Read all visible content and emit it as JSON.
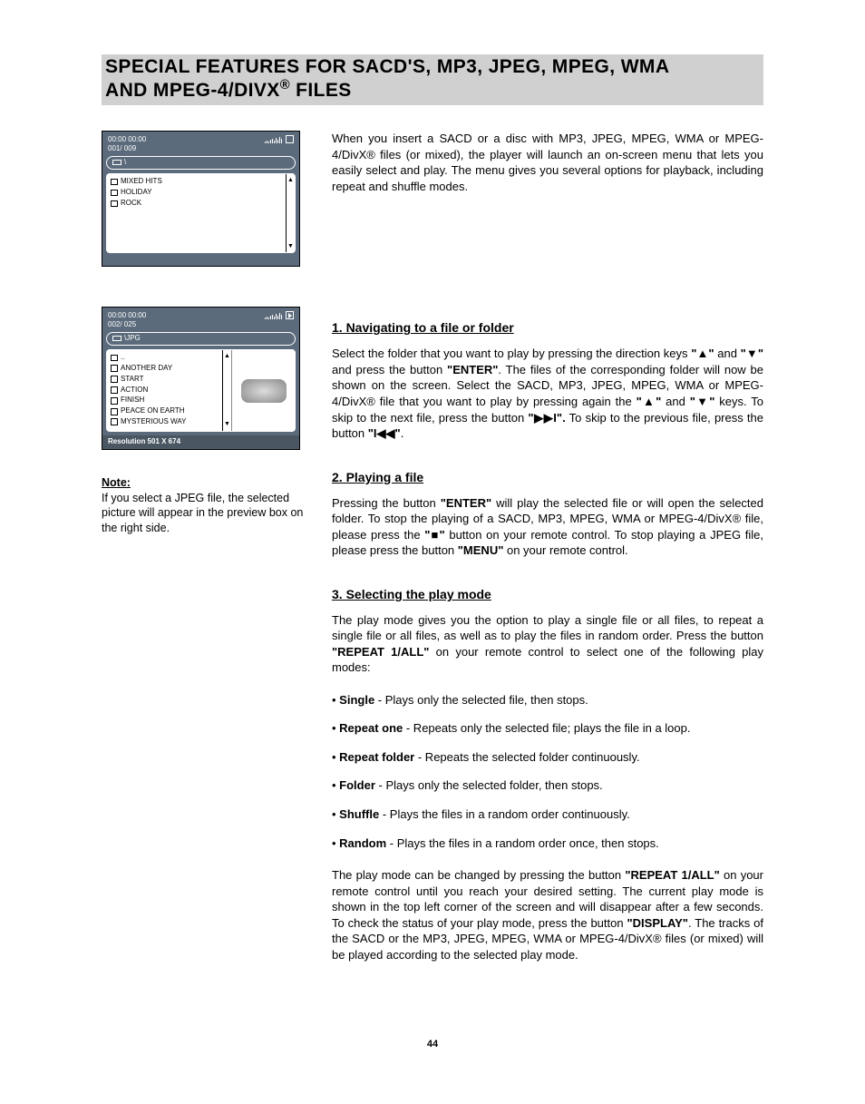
{
  "header": {
    "title_line1": "SPECIAL FEATURES FOR SACD'S, MP3, JPEG, MPEG, WMA",
    "title_line2a": "AND MPEG-4/DIVX",
    "title_line2b": " FILES"
  },
  "osd1": {
    "time": "00:00   00:00",
    "track": "001/ 009",
    "path": "\\",
    "items": [
      "MIXED HITS",
      "HOLIDAY",
      "ROCK"
    ]
  },
  "osd2": {
    "time": "00:00   00:00",
    "track": "002/ 025",
    "path": "\\JPG",
    "items": [
      "..",
      "ANOTHER DAY",
      "START",
      "ACTION",
      "FINISH",
      "PEACE ON EARTH",
      "MYSTERIOUS WAY"
    ],
    "footer": "Resolution   501 X  674"
  },
  "note": {
    "label": "Note:",
    "text": "If you select a JPEG file, the selected picture will appear in the preview box on the right side."
  },
  "intro": "When you insert a SACD or a disc with MP3, JPEG, MPEG, WMA or MPEG-4/DivX® files (or mixed), the player will launch an on-screen menu that lets you easily select and play. The menu gives you several options for playback, including repeat and shuffle modes.",
  "s1": {
    "heading": "1. Navigating to a file or folder",
    "p1a": "Select the folder that you want to play by pressing the direction keys ",
    "k_up": "\"▲\"",
    "p1b": " and ",
    "k_down": "\"▼\"",
    "p1c": " and press the button ",
    "k_enter": "\"ENTER\"",
    "p1d": ". The files of the corresponding folder will now be shown on the screen. Select the SACD, MP3, JPEG, MPEG, WMA  or MPEG-4/DivX® file that you want to play by pressing again the ",
    "p1e": " keys. To skip to the next file, press the button ",
    "k_next": "\"▶▶I\".",
    "p1f": " To skip to the previous file, press the button ",
    "k_prev": "\"I◀◀\"",
    "p1g": "."
  },
  "s2": {
    "heading": "2. Playing a file",
    "p1a": "Pressing the button ",
    "k_enter": "\"ENTER\"",
    "p1b": " will play the selected file or will open the selected folder. To stop the playing of a SACD, MP3, MPEG, WMA or MPEG-4/DivX® file, please press the ",
    "k_stop": "\"■\"",
    "p1c": " button on your remote control. To stop playing a JPEG file, please press the button ",
    "k_menu": "\"MENU\"",
    "p1d": " on your remote control."
  },
  "s3": {
    "heading": "3. Selecting the play mode",
    "intro_a": "The play mode gives you the option to play a single file or all files, to repeat a single file or all files, as well as to play the files in random order. Press the button ",
    "k_repeat": "\"REPEAT 1/ALL\"",
    "intro_b": " on your remote control to select one of the following play modes:",
    "modes": [
      {
        "name": "Single",
        "desc": " - Plays only the selected file, then stops."
      },
      {
        "name": "Repeat one",
        "desc": " - Repeats only the selected file; plays the file in a loop."
      },
      {
        "name": "Repeat folder",
        "desc": " - Repeats the selected folder continuously."
      },
      {
        "name": "Folder",
        "desc": " - Plays only the selected folder, then stops."
      },
      {
        "name": "Shuffle",
        "desc": " - Plays the files in a random order continuously."
      },
      {
        "name": "Random",
        "desc": " - Plays the files in a random order once, then stops."
      }
    ],
    "outro_a": "The play mode can be changed by pressing the button ",
    "outro_b": " on your remote control until you reach your desired setting. The current play mode is shown in the top left corner of the screen and will disappear after a few seconds. To check the status of your play mode, press the button ",
    "k_display": "\"DISPLAY\"",
    "outro_c": ". The tracks of the SACD or the MP3, JPEG, MPEG, WMA or MPEG-4/DivX® files (or mixed) will be played according to the selected play mode."
  },
  "pagenum": "44"
}
